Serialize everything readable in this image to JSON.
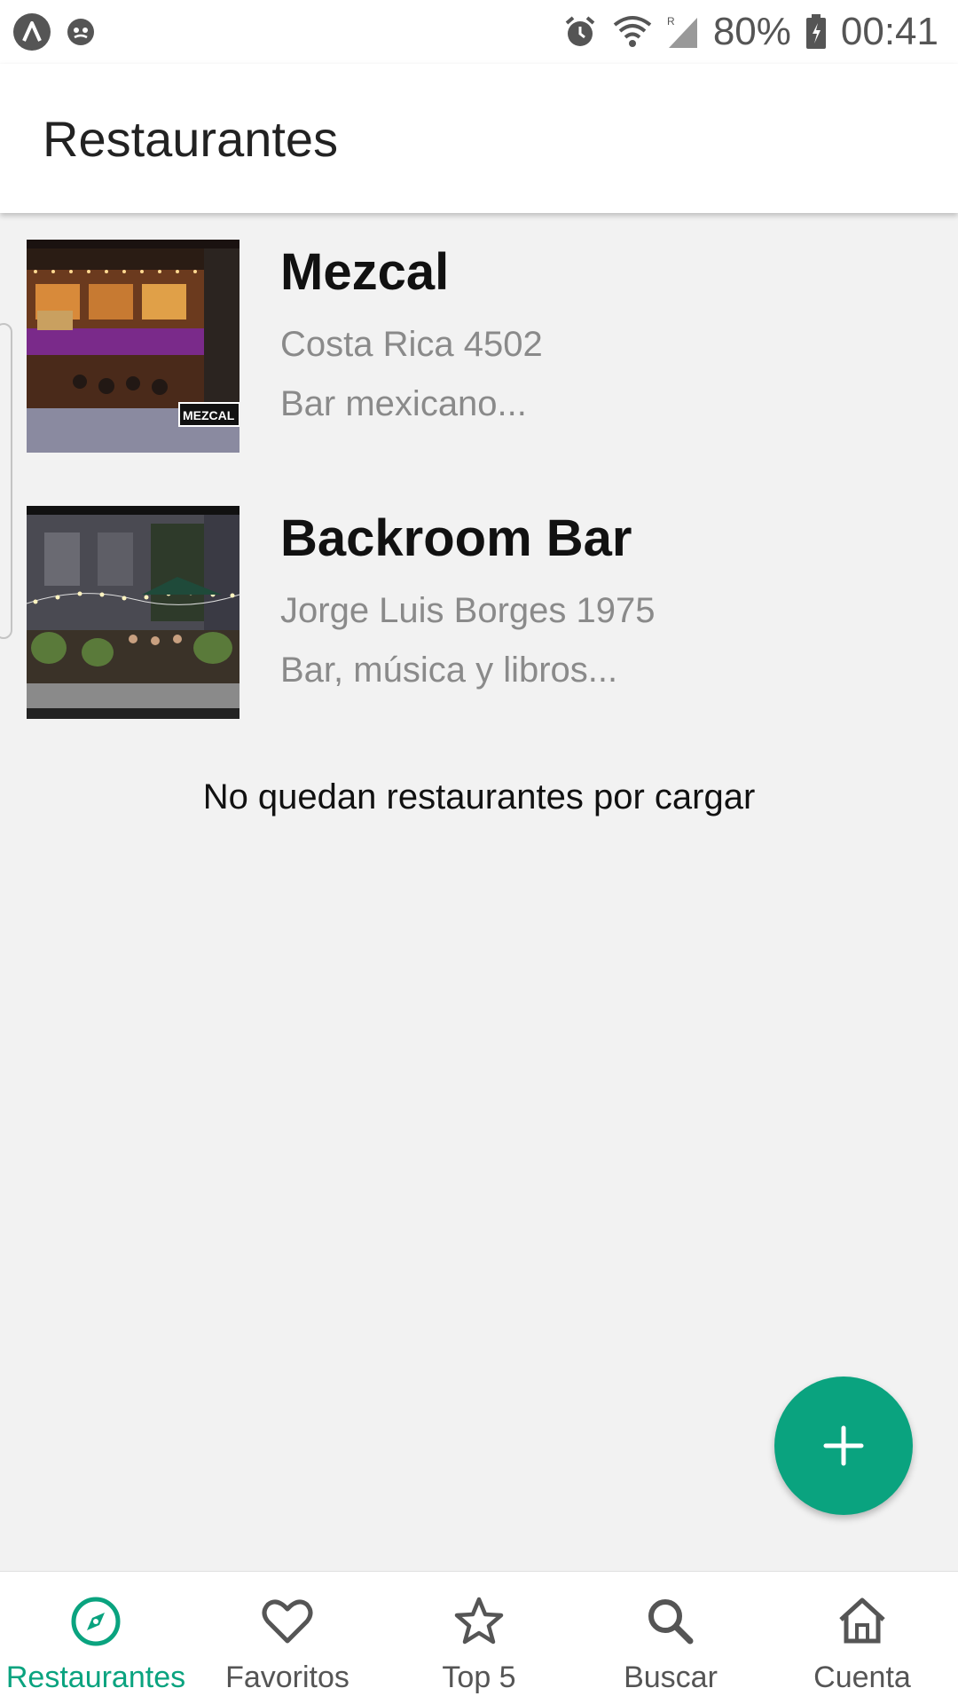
{
  "status_bar": {
    "battery": "80%",
    "time": "00:41",
    "icons": [
      "app-icon",
      "smiley-icon",
      "alarm-icon",
      "wifi-icon",
      "signal-icon",
      "battery-icon"
    ]
  },
  "app_bar": {
    "title": "Restaurantes"
  },
  "restaurants": [
    {
      "name": "Mezcal",
      "address": "Costa Rica 4502",
      "description": "Bar mexicano...",
      "image_sign": "MEZCAL"
    },
    {
      "name": "Backroom Bar",
      "address": "Jorge Luis Borges 1975",
      "description": "Bar, música y libros..."
    }
  ],
  "list_end_message": "No quedan restaurantes por cargar",
  "fab": {
    "icon": "plus-icon"
  },
  "bottom_nav": [
    {
      "label": "Restaurantes",
      "icon": "compass-icon",
      "active": true
    },
    {
      "label": "Favoritos",
      "icon": "heart-icon",
      "active": false
    },
    {
      "label": "Top 5",
      "icon": "star-icon",
      "active": false
    },
    {
      "label": "Buscar",
      "icon": "search-icon",
      "active": false
    },
    {
      "label": "Cuenta",
      "icon": "home-icon",
      "active": false
    }
  ],
  "colors": {
    "accent": "#0aa37f",
    "background": "#f2f2f2",
    "secondary_text": "#8a8a8a"
  }
}
